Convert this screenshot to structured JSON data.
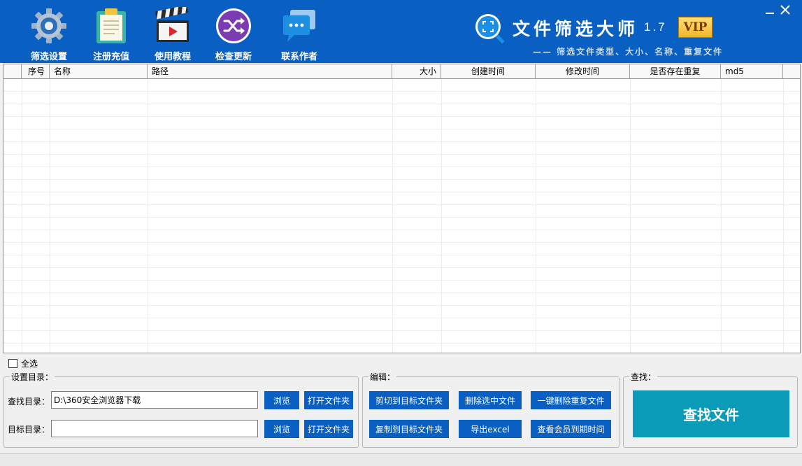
{
  "toolbar": {
    "items": [
      {
        "label": "筛选设置",
        "icon": "gear-icon"
      },
      {
        "label": "注册充值",
        "icon": "clipboard-icon"
      },
      {
        "label": "使用教程",
        "icon": "clapperboard-icon"
      },
      {
        "label": "检查更新",
        "icon": "shuffle-icon"
      },
      {
        "label": "联系作者",
        "icon": "chat-icon"
      }
    ]
  },
  "brand": {
    "title": "文件筛选大师",
    "version": "1.7",
    "badge": "VIP",
    "subtitle": "—— 筛选文件类型、大小、名称、重复文件"
  },
  "table": {
    "columns": [
      "序号",
      "名称",
      "路径",
      "大小",
      "创建时间",
      "修改时间",
      "是否存在重复",
      "md5"
    ],
    "rows": []
  },
  "select_all_label": "全选",
  "settings": {
    "title": "设置目录：",
    "search_dir_label": "查找目录：",
    "search_dir_value": "D:\\360安全浏览器下载",
    "target_dir_label": "目标目录：",
    "target_dir_value": "",
    "browse_label": "浏览",
    "open_folder_label": "打开文件夹"
  },
  "edit": {
    "title": "编辑：",
    "cut_label": "剪切到目标文件夹",
    "delete_selected_label": "删除选中文件",
    "delete_dups_label": "一键删除重复文件",
    "copy_label": "复制到目标文件夹",
    "export_label": "导出excel",
    "check_member_label": "查看会员到期时间"
  },
  "search": {
    "title": "查找：",
    "find_label": "查找文件"
  },
  "colors": {
    "header": "#0a5fc2",
    "button": "#0a5fc2",
    "find_button": "#0a9bb8",
    "vip": "#f2b52a"
  }
}
